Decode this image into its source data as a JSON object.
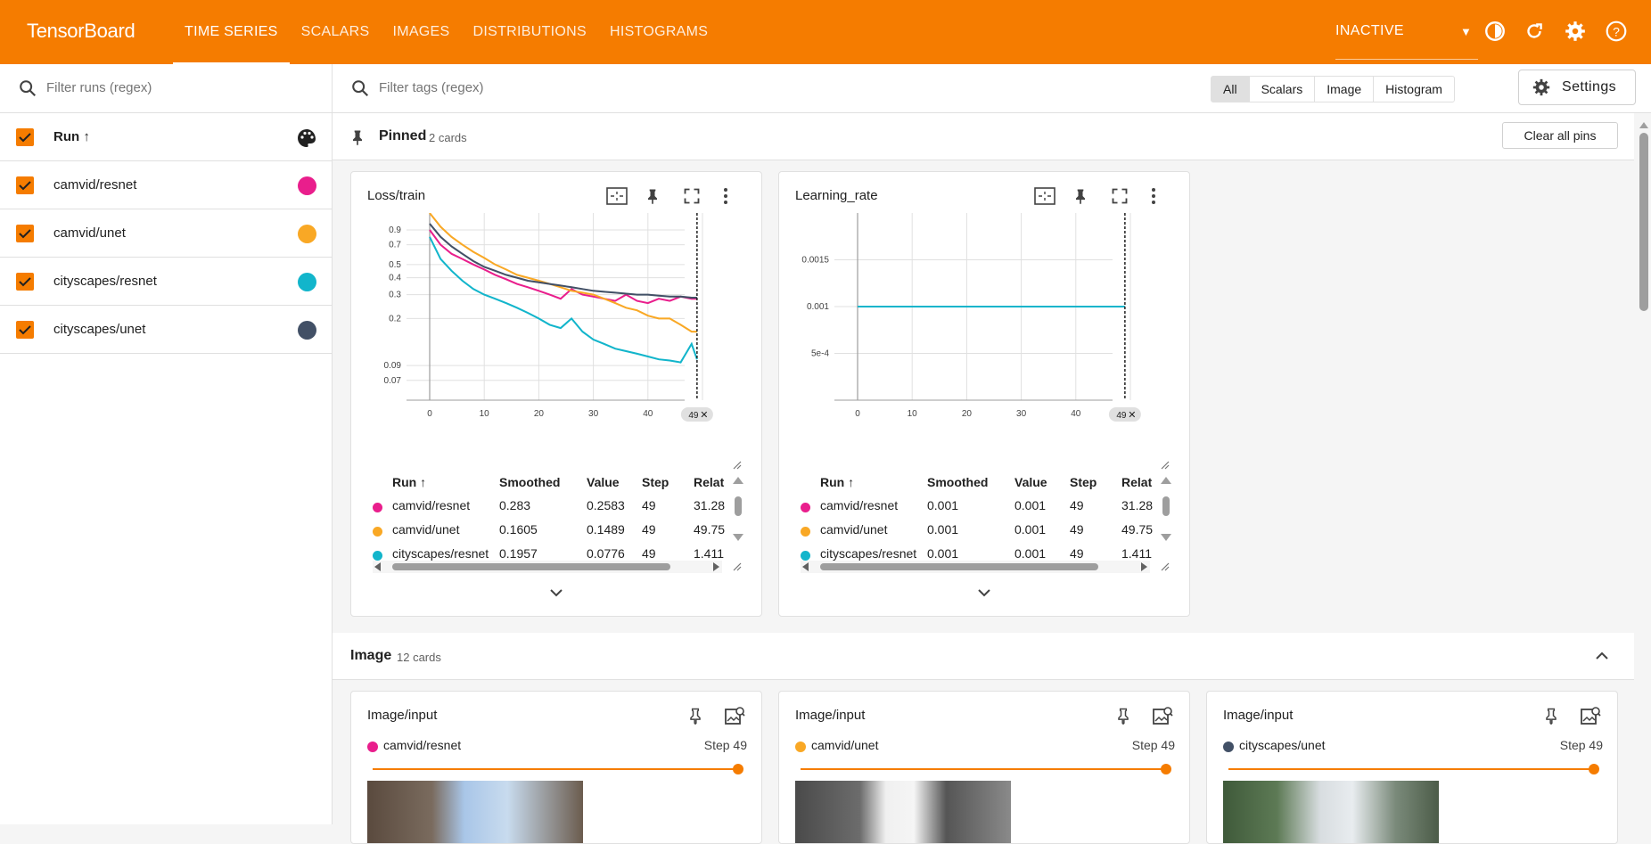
{
  "app": {
    "brand": "TensorBoard"
  },
  "nav": {
    "tabs": [
      "TIME SERIES",
      "SCALARS",
      "IMAGES",
      "DISTRIBUTIONS",
      "HISTOGRAMS"
    ],
    "active_tab": "TIME SERIES",
    "reload_status": "INACTIVE"
  },
  "colors": {
    "accent": "#f57c00",
    "camvid_resnet": "#e91e8c",
    "camvid_unet": "#f9a825",
    "cityscapes_resnet": "#12b5cb",
    "cityscapes_unet": "#425066"
  },
  "sidebar": {
    "filter_placeholder": "Filter runs (regex)",
    "header": "Run ↑",
    "runs": [
      {
        "name": "camvid/resnet",
        "color": "#e91e8c"
      },
      {
        "name": "camvid/unet",
        "color": "#f9a825"
      },
      {
        "name": "cityscapes/resnet",
        "color": "#12b5cb"
      },
      {
        "name": "cityscapes/unet",
        "color": "#425066"
      }
    ]
  },
  "toolbar": {
    "filter_placeholder": "Filter tags (regex)",
    "segments": [
      "All",
      "Scalars",
      "Image",
      "Histogram"
    ],
    "active_segment": "All",
    "settings_label": "Settings"
  },
  "pinned": {
    "title": "Pinned",
    "count": "2 cards",
    "clear_label": "Clear all pins",
    "cards": [
      {
        "title": "Loss/train",
        "x_ticks": [
          "0",
          "10",
          "20",
          "30",
          "40"
        ],
        "y_ticks": [
          "0.9",
          "0.7",
          "0.5",
          "0.4",
          "0.3",
          "0.2",
          "0.09",
          "0.07"
        ],
        "step_marker": "49",
        "table_headers": [
          "Run ↑",
          "Smoothed",
          "Value",
          "Step",
          "Relat"
        ],
        "rows": [
          {
            "run": "camvid/resnet",
            "smoothed": "0.283",
            "value": "0.2583",
            "step": "49",
            "rel": "31.28",
            "color": "#e91e8c"
          },
          {
            "run": "camvid/unet",
            "smoothed": "0.1605",
            "value": "0.1489",
            "step": "49",
            "rel": "49.75",
            "color": "#f9a825"
          },
          {
            "run": "cityscapes/resnet",
            "smoothed": "0.1957",
            "value": "0.0776",
            "step": "49",
            "rel": "1.411",
            "color": "#12b5cb"
          }
        ]
      },
      {
        "title": "Learning_rate",
        "x_ticks": [
          "0",
          "10",
          "20",
          "30",
          "40"
        ],
        "y_ticks": [
          "0.0015",
          "0.001",
          "5e-4"
        ],
        "step_marker": "49",
        "table_headers": [
          "Run ↑",
          "Smoothed",
          "Value",
          "Step",
          "Relat"
        ],
        "rows": [
          {
            "run": "camvid/resnet",
            "smoothed": "0.001",
            "value": "0.001",
            "step": "49",
            "rel": "31.28",
            "color": "#e91e8c"
          },
          {
            "run": "camvid/unet",
            "smoothed": "0.001",
            "value": "0.001",
            "step": "49",
            "rel": "49.75",
            "color": "#f9a825"
          },
          {
            "run": "cityscapes/resnet",
            "smoothed": "0.001",
            "value": "0.001",
            "step": "49",
            "rel": "1.411",
            "color": "#12b5cb"
          }
        ]
      }
    ]
  },
  "image_section": {
    "title": "Image",
    "count": "12 cards",
    "cards": [
      {
        "title": "Image/input",
        "run": "camvid/resnet",
        "step": "Step 49",
        "color": "#e91e8c"
      },
      {
        "title": "Image/input",
        "run": "camvid/unet",
        "step": "Step 49",
        "color": "#f9a825"
      },
      {
        "title": "Image/input",
        "run": "cityscapes/unet",
        "step": "Step 49",
        "color": "#425066"
      }
    ]
  },
  "chart_data": [
    {
      "type": "line",
      "title": "Loss/train",
      "xlabel": "",
      "ylabel": "",
      "x": [
        0,
        2,
        4,
        6,
        8,
        10,
        12,
        14,
        16,
        18,
        20,
        22,
        24,
        26,
        28,
        30,
        32,
        34,
        36,
        38,
        40,
        42,
        44,
        46,
        48,
        49
      ],
      "ylim": [
        0.05,
        1.2
      ],
      "y_scale": "log",
      "series": [
        {
          "name": "camvid/resnet",
          "values": [
            0.9,
            0.7,
            0.6,
            0.55,
            0.5,
            0.46,
            0.42,
            0.39,
            0.36,
            0.34,
            0.32,
            0.3,
            0.28,
            0.33,
            0.3,
            0.29,
            0.28,
            0.27,
            0.3,
            0.27,
            0.26,
            0.28,
            0.27,
            0.29,
            0.28,
            0.28
          ]
        },
        {
          "name": "camvid/unet",
          "values": [
            1.2,
            0.95,
            0.8,
            0.7,
            0.62,
            0.56,
            0.5,
            0.46,
            0.42,
            0.4,
            0.38,
            0.36,
            0.34,
            0.32,
            0.31,
            0.3,
            0.28,
            0.26,
            0.24,
            0.23,
            0.21,
            0.2,
            0.2,
            0.18,
            0.16,
            0.16
          ]
        },
        {
          "name": "cityscapes/resnet",
          "values": [
            0.8,
            0.55,
            0.45,
            0.38,
            0.33,
            0.3,
            0.28,
            0.26,
            0.24,
            0.22,
            0.2,
            0.18,
            0.17,
            0.2,
            0.16,
            0.14,
            0.13,
            0.12,
            0.115,
            0.11,
            0.105,
            0.1,
            0.098,
            0.095,
            0.13,
            0.1
          ]
        },
        {
          "name": "cityscapes/unet",
          "values": [
            1.0,
            0.8,
            0.68,
            0.6,
            0.53,
            0.48,
            0.45,
            0.42,
            0.4,
            0.38,
            0.37,
            0.36,
            0.35,
            0.34,
            0.33,
            0.32,
            0.315,
            0.31,
            0.305,
            0.3,
            0.3,
            0.295,
            0.29,
            0.29,
            0.285,
            0.285
          ]
        }
      ]
    },
    {
      "type": "line",
      "title": "Learning_rate",
      "xlabel": "",
      "ylabel": "",
      "x": [
        0,
        49
      ],
      "ylim": [
        0,
        0.002
      ],
      "series": [
        {
          "name": "cityscapes/resnet",
          "values": [
            0.001,
            0.001
          ]
        }
      ]
    }
  ]
}
